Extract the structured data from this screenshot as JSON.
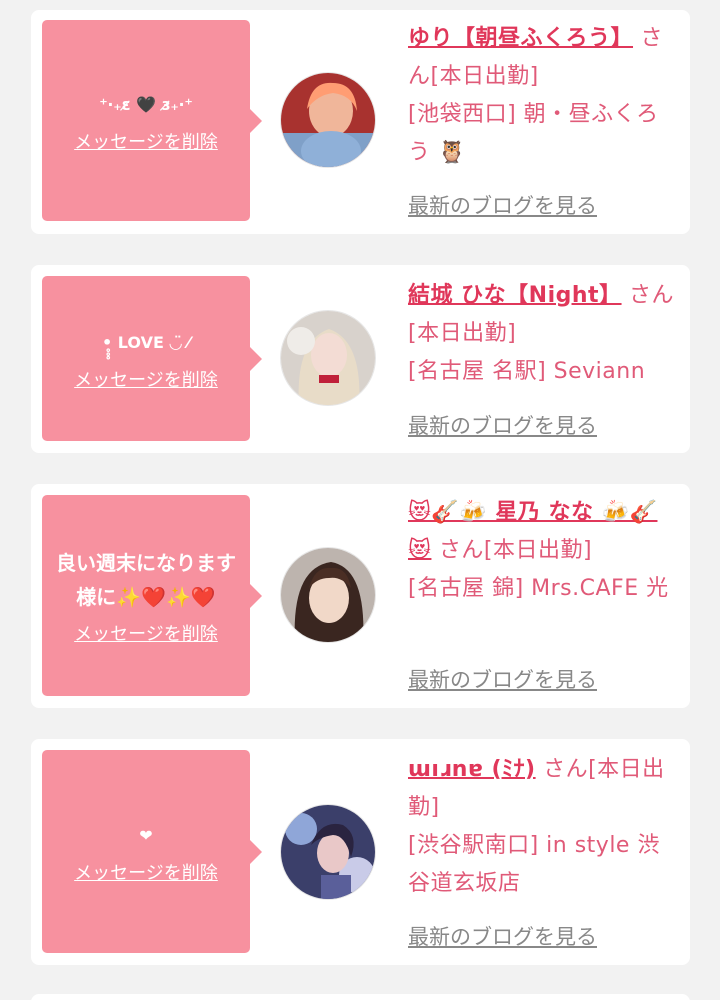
{
  "colors": {
    "bubble": "#f7919f",
    "name": "#e0375a",
    "info": "#e05a78",
    "blog_link": "#888888",
    "background": "#f2f2f2"
  },
  "delete_label": "メッセージを削除",
  "blog_label": "最新のブログを見る",
  "messages": [
    {
      "message": "⁺‧₊ɛ̷ 🖤 ɜ̷₊‧⁺",
      "name": "ゆり【朝昼ふくろう】",
      "suffix": " さん[本日出勤]",
      "shop": "[池袋西口] 朝・昼ふくろう 🦉"
    },
    {
      "message": "•̥̥̥ LOVE ◡̈ ⁄",
      "name": "結城 ひな【Night】",
      "suffix": " さん[本日出勤]",
      "shop": "[名古屋 名駅] Seviann"
    },
    {
      "message": "良い週末になります様に✨❤️✨❤️",
      "name": "😻🎸🍻 星乃 なな 🍻🎸😻",
      "suffix": " さん[本日出勤]",
      "shop": "[名古屋 錦] Mrs.CAFE 光"
    },
    {
      "message": "❤",
      "name": "ɯıɹnɐ (ﾐﾅ)",
      "suffix": " さん[本日出勤]",
      "shop": "[渋谷駅南口] in style 渋谷道玄坂店"
    }
  ]
}
